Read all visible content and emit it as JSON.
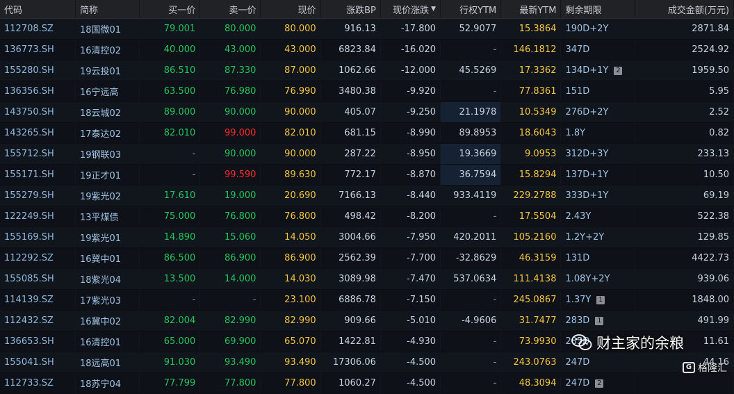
{
  "headers": [
    "代码",
    "简称",
    "买一价",
    "卖一价",
    "现价",
    "涨跌BP",
    "现价涨跌",
    "行权YTM",
    "最新YTM",
    "剩余期限",
    "成交金额(万元)"
  ],
  "sort_indicator": "▼",
  "rows": [
    {
      "code": "112708.SZ",
      "name": "18国微01",
      "bid": "79.001",
      "ask": "80.000",
      "price": "80.000",
      "bp": "916.13",
      "chg": "-17.800",
      "exytm": "52.9077",
      "ytm": "15.3864",
      "term": "190D+2Y",
      "badge": "",
      "amount": "2871.84"
    },
    {
      "code": "136773.SH",
      "name": "16清控02",
      "bid": "40.000",
      "ask": "43.000",
      "price": "43.000",
      "bp": "6823.84",
      "chg": "-16.020",
      "exytm": "-",
      "ytm": "146.1812",
      "term": "347D",
      "badge": "",
      "amount": "2524.92"
    },
    {
      "code": "155280.SH",
      "name": "19云投01",
      "bid": "86.510",
      "ask": "87.330",
      "price": "87.000",
      "bp": "1062.66",
      "chg": "-12.000",
      "exytm": "45.5269",
      "ytm": "17.3362",
      "term": "134D+1Y",
      "badge": "2",
      "amount": "1959.50"
    },
    {
      "code": "136356.SH",
      "name": "16宁远高",
      "bid": "63.500",
      "ask": "76.980",
      "price": "76.990",
      "bp": "3480.38",
      "chg": "-9.920",
      "exytm": "-",
      "ytm": "77.8361",
      "term": "151D",
      "badge": "",
      "amount": "5.95"
    },
    {
      "code": "143750.SH",
      "name": "18云城02",
      "bid": "89.000",
      "ask": "90.000",
      "price": "90.000",
      "bp": "405.07",
      "chg": "-9.250",
      "exytm": "21.1978",
      "ytm": "10.5349",
      "term": "276D+2Y",
      "badge": "",
      "amount": "2.52"
    },
    {
      "code": "143265.SH",
      "name": "17泰达02",
      "bid": "82.010",
      "ask": "99.000",
      "price": "82.010",
      "bp": "681.15",
      "chg": "-8.990",
      "exytm": "89.8953",
      "ytm": "18.6043",
      "term": "1.8Y",
      "badge": "",
      "amount": "0.82"
    },
    {
      "code": "155712.SH",
      "name": "19钢联03",
      "bid": "-",
      "ask": "90.000",
      "price": "90.000",
      "bp": "287.22",
      "chg": "-8.950",
      "exytm": "19.3669",
      "ytm": "9.0953",
      "term": "312D+3Y",
      "badge": "",
      "amount": "233.13"
    },
    {
      "code": "155171.SH",
      "name": "19正才01",
      "bid": "-",
      "ask": "99.590",
      "price": "89.630",
      "bp": "772.17",
      "chg": "-8.870",
      "exytm": "36.7594",
      "ytm": "15.8294",
      "term": "137D+1Y",
      "badge": "",
      "amount": "10.50"
    },
    {
      "code": "155279.SH",
      "name": "19紫光02",
      "bid": "17.610",
      "ask": "19.000",
      "price": "20.690",
      "bp": "7166.13",
      "chg": "-8.440",
      "exytm": "933.4119",
      "ytm": "229.2788",
      "term": "333D+1Y",
      "badge": "",
      "amount": "69.19"
    },
    {
      "code": "122249.SH",
      "name": "13平煤债",
      "bid": "75.000",
      "ask": "76.800",
      "price": "76.800",
      "bp": "498.42",
      "chg": "-8.200",
      "exytm": "-",
      "ytm": "17.5504",
      "term": "2.43Y",
      "badge": "",
      "amount": "522.38"
    },
    {
      "code": "155169.SH",
      "name": "19紫光01",
      "bid": "14.890",
      "ask": "15.060",
      "price": "14.050",
      "bp": "3004.66",
      "chg": "-7.950",
      "exytm": "420.2011",
      "ytm": "105.2160",
      "term": "1.2Y+2Y",
      "badge": "",
      "amount": "129.85"
    },
    {
      "code": "112292.SZ",
      "name": "16冀中01",
      "bid": "86.500",
      "ask": "86.900",
      "price": "86.900",
      "bp": "2562.39",
      "chg": "-7.700",
      "exytm": "-32.8629",
      "ytm": "46.3159",
      "term": "131D",
      "badge": "",
      "amount": "4422.73"
    },
    {
      "code": "155085.SH",
      "name": "18紫光04",
      "bid": "13.500",
      "ask": "14.000",
      "price": "14.030",
      "bp": "3089.98",
      "chg": "-7.470",
      "exytm": "537.0634",
      "ytm": "111.4138",
      "term": "1.08Y+2Y",
      "badge": "",
      "amount": "939.06"
    },
    {
      "code": "114139.SZ",
      "name": "17紫光03",
      "bid": "-",
      "ask": "-",
      "price": "23.100",
      "bp": "6886.78",
      "chg": "-7.150",
      "exytm": "-",
      "ytm": "245.0867",
      "term": "1.37Y",
      "badge": "1",
      "amount": "1848.00"
    },
    {
      "code": "112432.SZ",
      "name": "16冀中02",
      "bid": "82.004",
      "ask": "82.990",
      "price": "82.990",
      "bp": "909.66",
      "chg": "-5.010",
      "exytm": "-4.9606",
      "ytm": "31.7477",
      "term": "283D",
      "badge": "1",
      "amount": "491.99"
    },
    {
      "code": "136653.SH",
      "name": "16清控01",
      "bid": "65.000",
      "ask": "69.900",
      "price": "65.070",
      "bp": "1422.81",
      "chg": "-4.930",
      "exytm": "-",
      "ytm": "73.9930",
      "term": "285D",
      "badge": "",
      "amount": "11.61"
    },
    {
      "code": "155041.SH",
      "name": "18远高01",
      "bid": "91.030",
      "ask": "93.490",
      "price": "93.490",
      "bp": "17306.06",
      "chg": "-4.500",
      "exytm": "-",
      "ytm": "243.0763",
      "term": "247D",
      "badge": "",
      "amount": "44.16"
    },
    {
      "code": "112733.SZ",
      "name": "18苏宁04",
      "bid": "77.799",
      "ask": "77.800",
      "price": "77.800",
      "bp": "1060.27",
      "chg": "-4.500",
      "exytm": "-",
      "ytm": "48.3094",
      "term": "247D",
      "badge": "2",
      "amount": ""
    }
  ],
  "watermark": {
    "text": "财主家的余粮",
    "logo": "格隆汇"
  },
  "colors": {
    "bid": "#22c55e",
    "ask_high": "#ff2b2b",
    "price": "#f4c542",
    "code": "#8fb8e0"
  }
}
